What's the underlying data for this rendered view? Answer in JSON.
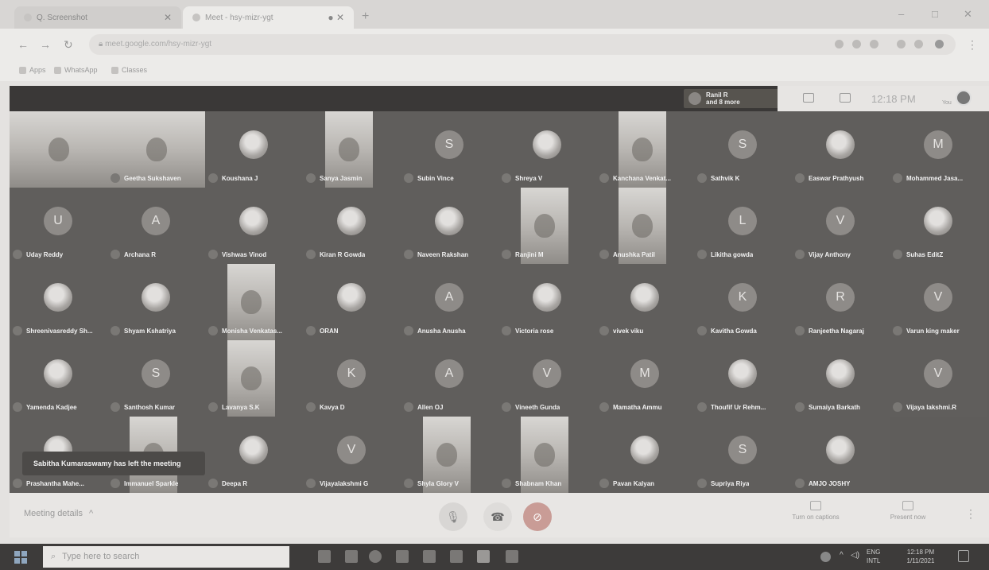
{
  "browser": {
    "tabs": [
      {
        "label": "Q. Screenshot",
        "active": false
      },
      {
        "label": "Meet - hsy-mizr-ygt",
        "active": true
      }
    ],
    "url": "meet.google.com/hsy-mizr-ygt",
    "bookmarks": [
      "Apps",
      "WhatsApp",
      "Classes"
    ]
  },
  "meet": {
    "presenter": {
      "line1": "Ranil R",
      "line2": "and 8 more"
    },
    "clock": "12:18 PM",
    "participant_count": "You",
    "toast": "Sabitha Kumaraswamy has left the meeting",
    "participants": [
      {
        "name": "",
        "kind": "video"
      },
      {
        "name": "Geetha Sukshaven",
        "kind": "video"
      },
      {
        "name": "Koushana J",
        "kind": "photo"
      },
      {
        "name": "Sanya Jasmin",
        "kind": "video"
      },
      {
        "name": "Subin Vince",
        "kind": "letter",
        "initial": "S"
      },
      {
        "name": "Shreya V",
        "kind": "photo"
      },
      {
        "name": "Kanchana Venkat...",
        "kind": "video"
      },
      {
        "name": "Sathvik K",
        "kind": "letter",
        "initial": "S"
      },
      {
        "name": "Easwar Prathyush",
        "kind": "photo"
      },
      {
        "name": "Mohammed Jasa...",
        "kind": "letter",
        "initial": "M"
      },
      {
        "name": "Uday Reddy",
        "kind": "letter",
        "initial": "U"
      },
      {
        "name": "Archana R",
        "kind": "letter",
        "initial": "A"
      },
      {
        "name": "Vishwas Vinod",
        "kind": "photo"
      },
      {
        "name": "Kiran R Gowda",
        "kind": "photo"
      },
      {
        "name": "Naveen Rakshan",
        "kind": "photo"
      },
      {
        "name": "Ranjini M",
        "kind": "video"
      },
      {
        "name": "Anushka Patil",
        "kind": "video"
      },
      {
        "name": "Likitha gowda",
        "kind": "letter",
        "initial": "L"
      },
      {
        "name": "Vijay Anthony",
        "kind": "letter",
        "initial": "V"
      },
      {
        "name": "Suhas EditZ",
        "kind": "photo"
      },
      {
        "name": "Shreenivasreddy Sh...",
        "kind": "photo"
      },
      {
        "name": "Shyam Kshatriya",
        "kind": "photo"
      },
      {
        "name": "Monisha Venkatas...",
        "kind": "video"
      },
      {
        "name": "ORAN",
        "kind": "photo"
      },
      {
        "name": "Anusha Anusha",
        "kind": "letter",
        "initial": "A"
      },
      {
        "name": "Victoria rose",
        "kind": "photo"
      },
      {
        "name": "vivek viku",
        "kind": "photo"
      },
      {
        "name": "Kavitha Gowda",
        "kind": "letter",
        "initial": "K"
      },
      {
        "name": "Ranjeetha Nagaraj",
        "kind": "letter",
        "initial": "R"
      },
      {
        "name": "Varun king maker",
        "kind": "letter",
        "initial": "V"
      },
      {
        "name": "Yamenda Kadjee",
        "kind": "photo"
      },
      {
        "name": "Santhosh Kumar",
        "kind": "letter",
        "initial": "S"
      },
      {
        "name": "Lavanya S.K",
        "kind": "video"
      },
      {
        "name": "Kavya D",
        "kind": "letter",
        "initial": "K"
      },
      {
        "name": "Allen OJ",
        "kind": "letter",
        "initial": "A"
      },
      {
        "name": "Vineeth Gunda",
        "kind": "letter",
        "initial": "V"
      },
      {
        "name": "Mamatha Ammu",
        "kind": "letter",
        "initial": "M"
      },
      {
        "name": "Thoufif Ur Rehm...",
        "kind": "photo"
      },
      {
        "name": "Sumaiya Barkath",
        "kind": "photo"
      },
      {
        "name": "Vijaya lakshmi.R",
        "kind": "letter",
        "initial": "V"
      },
      {
        "name": "Prashantha Mahe...",
        "kind": "photo"
      },
      {
        "name": "Immanuel Sparkle",
        "kind": "video"
      },
      {
        "name": "Deepa R",
        "kind": "photo"
      },
      {
        "name": "Vijayalakshmi G",
        "kind": "letter",
        "initial": "V"
      },
      {
        "name": "Shyla Glory V",
        "kind": "video"
      },
      {
        "name": "Shabnam Khan",
        "kind": "video"
      },
      {
        "name": "Pavan Kalyan",
        "kind": "photo"
      },
      {
        "name": "Supriya Riya",
        "kind": "letter",
        "initial": "S"
      },
      {
        "name": "AMJO JOSHY",
        "kind": "photo"
      }
    ]
  },
  "controls": {
    "meeting_details": "Meeting details",
    "captions": "Turn on captions",
    "present": "Present now"
  },
  "taskbar": {
    "search_placeholder": "Type here to search",
    "lang": "ENG",
    "region": "INTL",
    "time": "12:18 PM",
    "date": "1/11/2021"
  }
}
